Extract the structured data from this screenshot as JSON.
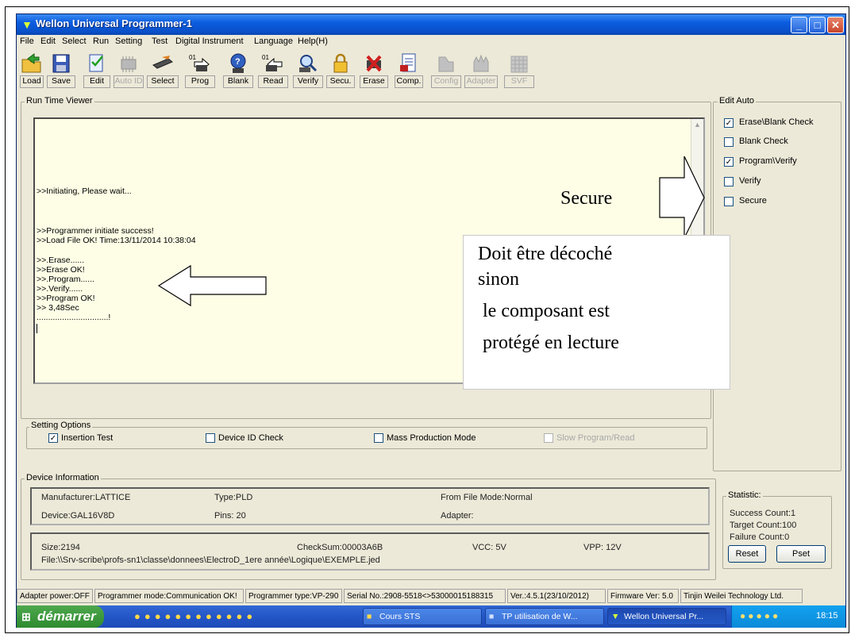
{
  "window": {
    "title": "Wellon Universal Programmer-1",
    "controls": [
      "_",
      "□",
      "✕"
    ]
  },
  "menu": [
    "File",
    "Edit",
    "Select",
    "Run",
    "Setting",
    "Test",
    "Digital Instrument",
    "Language",
    "Help(H)"
  ],
  "toolbar": [
    {
      "label": "Load",
      "icon": "load-folder-icon",
      "enabled": true
    },
    {
      "label": "Save",
      "icon": "save-disk-icon",
      "enabled": true
    },
    {
      "label": "Edit",
      "icon": "edit-icon",
      "enabled": true
    },
    {
      "label": "Auto ID",
      "icon": "auto-id-chip-icon",
      "enabled": false
    },
    {
      "label": "Select",
      "icon": "select-chip-icon",
      "enabled": true
    },
    {
      "label": "Prog",
      "icon": "program-chip-icon",
      "enabled": true
    },
    {
      "label": "Blank",
      "icon": "blank-check-icon",
      "enabled": true
    },
    {
      "label": "Read",
      "icon": "read-chip-icon",
      "enabled": true
    },
    {
      "label": "Verify",
      "icon": "verify-icon",
      "enabled": true
    },
    {
      "label": "Secu.",
      "icon": "padlock-icon",
      "enabled": true
    },
    {
      "label": "Erase",
      "icon": "erase-chip-icon",
      "enabled": true
    },
    {
      "label": "Comp.",
      "icon": "compare-icon",
      "enabled": true
    },
    {
      "label": "Config",
      "icon": "config-icon",
      "enabled": false
    },
    {
      "label": "Adapter",
      "icon": "adapter-icon",
      "enabled": false
    },
    {
      "label": "SVF",
      "icon": "svf-icon",
      "enabled": false
    }
  ],
  "run_time_viewer": {
    "title": "Run Time Viewer",
    "lines": [
      ">>Initiating, Please wait...",
      ">>Programmer initiate success!",
      ">>Load File OK! Time:13/11/2014 10:38:04",
      ">>.Erase......",
      ">>Erase OK!",
      ">>.Program......",
      ">>.Verify......",
      ">>Program OK!",
      ">> 3,48Sec",
      "...............................!"
    ]
  },
  "edit_auto": {
    "title": "Edit Auto",
    "options": [
      {
        "label": "Erase\\Blank Check",
        "checked": true
      },
      {
        "label": "Blank Check",
        "checked": false
      },
      {
        "label": "Program\\Verify",
        "checked": true
      },
      {
        "label": "Verify",
        "checked": false
      },
      {
        "label": "Secure",
        "checked": false
      }
    ]
  },
  "setting_options": {
    "title": "Setting Options",
    "options": [
      {
        "label": "Insertion Test",
        "checked": true,
        "enabled": true
      },
      {
        "label": "Device ID Check",
        "checked": false,
        "enabled": true
      },
      {
        "label": "Mass Production Mode",
        "checked": false,
        "enabled": true
      },
      {
        "label": "Slow Program/Read",
        "checked": false,
        "enabled": false
      }
    ]
  },
  "device_info": {
    "title": "Device Information",
    "manufacturer": "Manufacturer:LATTICE",
    "type": "Type:PLD",
    "file_mode": "From File Mode:Normal",
    "device": "Device:GAL16V8D",
    "pins": "Pins: 20",
    "adapter": "Adapter:",
    "size": "Size:2194",
    "checksum": "CheckSum:00003A6B",
    "vcc": "VCC: 5V",
    "vpp": "VPP: 12V",
    "file": "File:\\\\Srv-scribe\\profs-sn1\\classe\\donnees\\ElectroD_1ere année\\Logique\\EXEMPLE.jed"
  },
  "statistic": {
    "title": "Statistic:",
    "success": "Success Count:1",
    "target": "Target Count:100",
    "failure": "Failure Count:0",
    "reset_label": "Reset",
    "pset_label": "Pset"
  },
  "status_bar": [
    "Adapter power:OFF",
    "Programmer mode:Communication OK!",
    "Programmer type:VP-290",
    "Serial No.:2908-5518<>53000015188315",
    "Ver.:4.5.1(23/10/2012)",
    "Firmware Ver: 5.0",
    "Tinjin Weilei Technology Ltd."
  ],
  "taskbar": {
    "start_label": "démarrer",
    "tasks": [
      "Cours STS",
      "TP utilisation de W...",
      "Wellon Universal Pr..."
    ],
    "clock": "18:15"
  },
  "annotations": {
    "secure_label": "Secure",
    "note_lines": [
      "Doit être décoché",
      "sinon",
      " le composant est",
      " protégé en lecture"
    ]
  }
}
